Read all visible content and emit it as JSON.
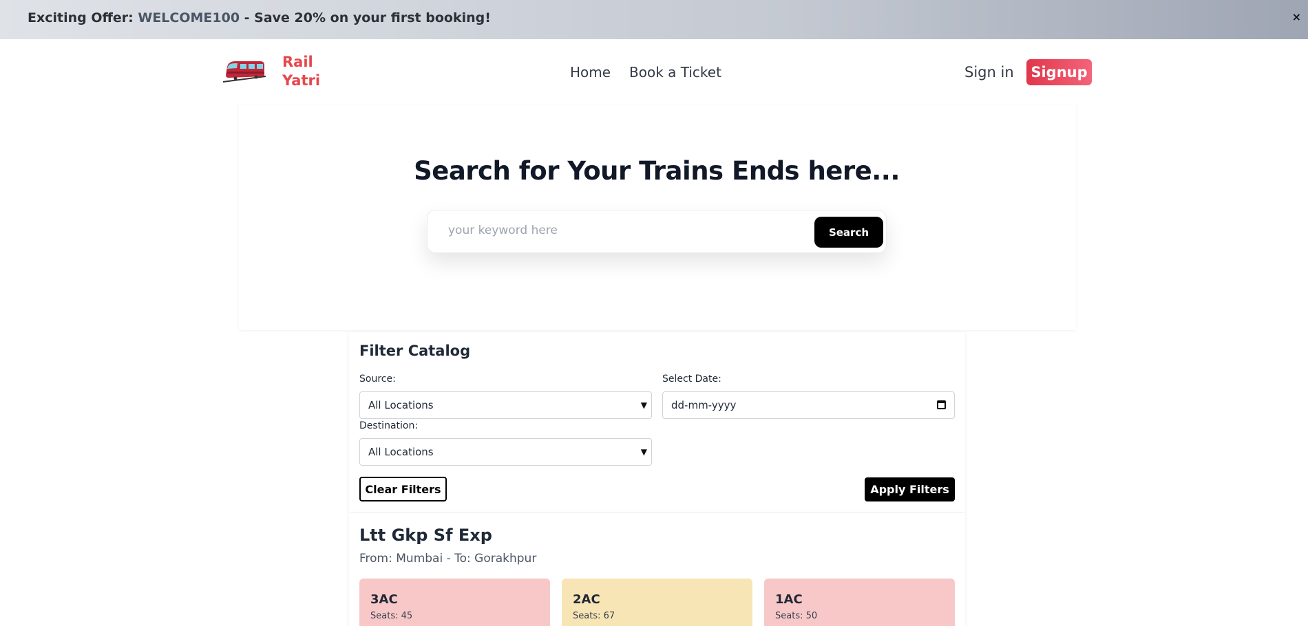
{
  "offer": {
    "prefix": "Exciting Offer: ",
    "code": "WELCOME100",
    "suffix": " - Save 20% on your first booking!",
    "close": "×"
  },
  "header": {
    "brand_line1": "Rail",
    "brand_line2": "Yatri",
    "nav": [
      {
        "label": "Home"
      },
      {
        "label": "Book a Ticket"
      }
    ],
    "signin": "Sign in",
    "signup": "Signup"
  },
  "hero": {
    "title": "Search for Your Trains Ends here...",
    "search_placeholder": "your keyword here",
    "search_button": "Search"
  },
  "filter": {
    "title": "Filter Catalog",
    "source_label": "Source:",
    "source_value": "All Locations",
    "date_label": "Select Date:",
    "date_placeholder": "dd-mm-yyyy",
    "destination_label": "Destination:",
    "destination_value": "All Locations",
    "clear_button": "Clear Filters",
    "apply_button": "Apply Filters"
  },
  "train": {
    "name": "Ltt Gkp Sf Exp",
    "route": "From: Mumbai - To: Gorakhpur",
    "classes": [
      {
        "name": "3AC",
        "seats": "Seats: 45",
        "color": "#f8c8c8"
      },
      {
        "name": "2AC",
        "seats": "Seats: 67",
        "color": "#f8e5b5"
      },
      {
        "name": "1AC",
        "seats": "Seats: 50",
        "color": "#f8c8c8"
      }
    ]
  },
  "colors": {
    "brand": "#e5484d",
    "signup": "#e1374b"
  }
}
